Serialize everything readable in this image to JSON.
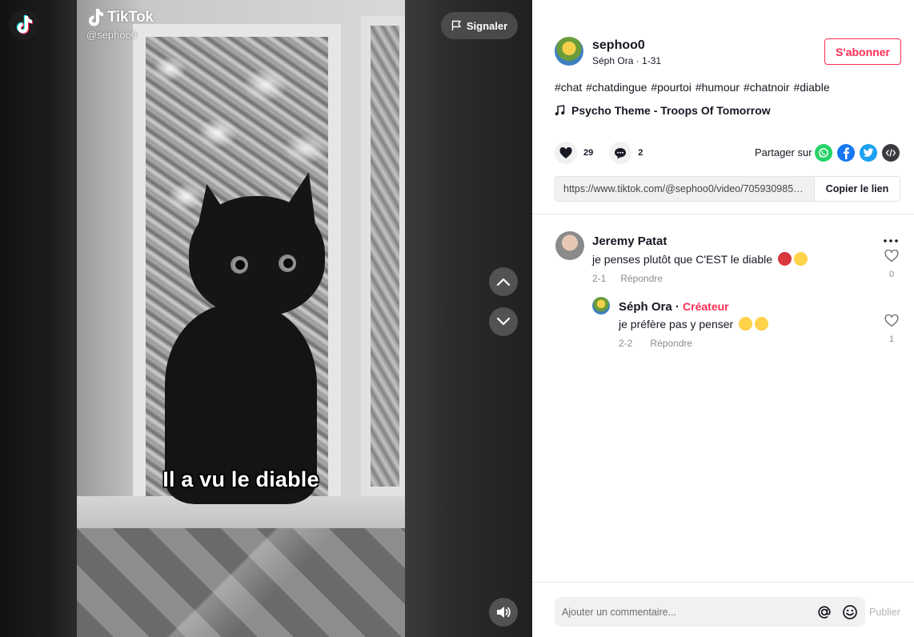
{
  "video": {
    "caption": "Il a vu le diable",
    "watermark_brand": "TikTok",
    "watermark_user": "@sephoo0",
    "report_label": "Signaler"
  },
  "author": {
    "username": "sephoo0",
    "nickname": "Séph Ora",
    "date": "1-31",
    "separator": " · ",
    "follow_label": "S'abonner"
  },
  "description": {
    "hashtags": [
      "#chat",
      "#chatdingue",
      "#pourtoi",
      "#humour",
      "#chatnoir",
      "#diable"
    ]
  },
  "music": {
    "title": "Psycho Theme - Troops Of Tomorrow"
  },
  "stats": {
    "likes": "29",
    "comments": "2"
  },
  "share": {
    "label": "Partager sur",
    "icons": [
      "whatsapp-icon",
      "facebook-icon",
      "twitter-icon",
      "embed-icon"
    ]
  },
  "link": {
    "url": "https://www.tiktok.com/@sephoo0/video/7059309853...",
    "copy_label": "Copier le lien"
  },
  "comments": [
    {
      "name": "Jeremy Patat",
      "text": "je penses plutôt que C'EST le diable",
      "emojis": [
        "devil",
        "laugh"
      ],
      "date": "2-1",
      "reply_label": "Répondre",
      "likes": "0",
      "replies": [
        {
          "name": "Séph Ora",
          "badge_sep": " · ",
          "badge": "Créateur",
          "text": "je préfère pas y penser",
          "emojis": [
            "sweat",
            "sweat"
          ],
          "date": "2-2",
          "reply_label": "Répondre",
          "likes": "1"
        }
      ]
    }
  ],
  "comment_box": {
    "placeholder": "Ajouter un commentaire...",
    "publish_label": "Publier"
  },
  "colors": {
    "accent": "#fe2c55",
    "whatsapp": "#25d366",
    "facebook": "#1877f2",
    "twitter": "#1da1f2"
  }
}
